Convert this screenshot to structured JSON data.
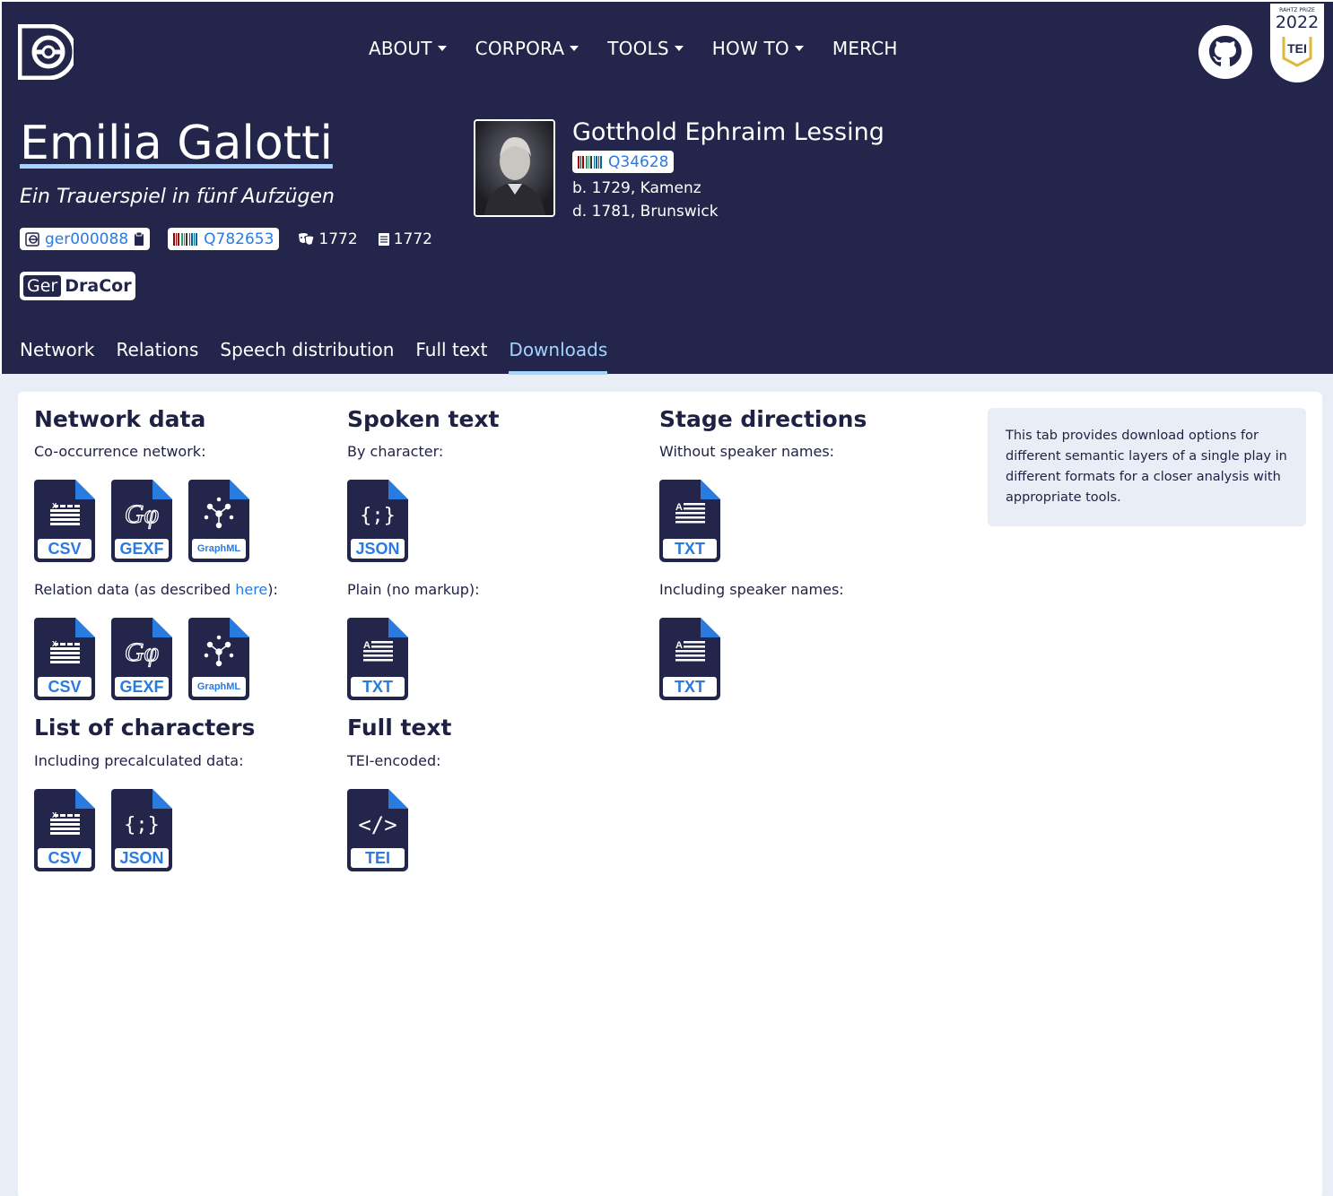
{
  "nav": {
    "items": [
      {
        "label": "ABOUT",
        "dropdown": true
      },
      {
        "label": "CORPORA",
        "dropdown": true
      },
      {
        "label": "TOOLS",
        "dropdown": true
      },
      {
        "label": "HOW TO",
        "dropdown": true
      },
      {
        "label": "MERCH",
        "dropdown": false
      }
    ],
    "badge": {
      "small": "RAHTZ PRIZE",
      "year": "2022",
      "label": "TEI"
    }
  },
  "play": {
    "title": "Emilia Galotti",
    "subtitle": "Ein Trauerspiel in fünf Aufzügen",
    "id": "ger000088",
    "wikidata": "Q782653",
    "premiere_year": "1772",
    "print_year": "1772",
    "corpus_prefix": "Ger",
    "corpus_name": "DraCor"
  },
  "author": {
    "name": "Gotthold Ephraim Lessing",
    "wikidata": "Q34628",
    "born": "b. 1729, Kamenz",
    "died": "d. 1781, Brunswick"
  },
  "tabs": [
    "Network",
    "Relations",
    "Speech distribution",
    "Full text",
    "Downloads"
  ],
  "active_tab": "Downloads",
  "downloads": {
    "network": {
      "heading": "Network data",
      "label1": "Co-occurrence network:",
      "label2_prefix": "Relation data (as described ",
      "label2_link": "here",
      "label2_suffix": "):",
      "formats": [
        "CSV",
        "GEXF",
        "GraphML"
      ]
    },
    "spoken": {
      "heading": "Spoken text",
      "label1": "By character:",
      "label2": "Plain (no markup):",
      "format1": "JSON",
      "format2": "TXT"
    },
    "stage": {
      "heading": "Stage directions",
      "label1": "Without speaker names:",
      "label2": "Including speaker names:",
      "format": "TXT"
    },
    "characters": {
      "heading": "List of characters",
      "label": "Including precalculated data:",
      "formats": [
        "CSV",
        "JSON"
      ]
    },
    "fulltext": {
      "heading": "Full text",
      "label": "TEI-encoded:",
      "format": "TEI"
    },
    "info": "This tab provides download options for different semantic layers of a single play in different formats for a closer analysis with appropriate tools."
  },
  "colors": {
    "navy": "#23264a",
    "accent": "#a3d3ff",
    "link": "#2a7be0"
  }
}
